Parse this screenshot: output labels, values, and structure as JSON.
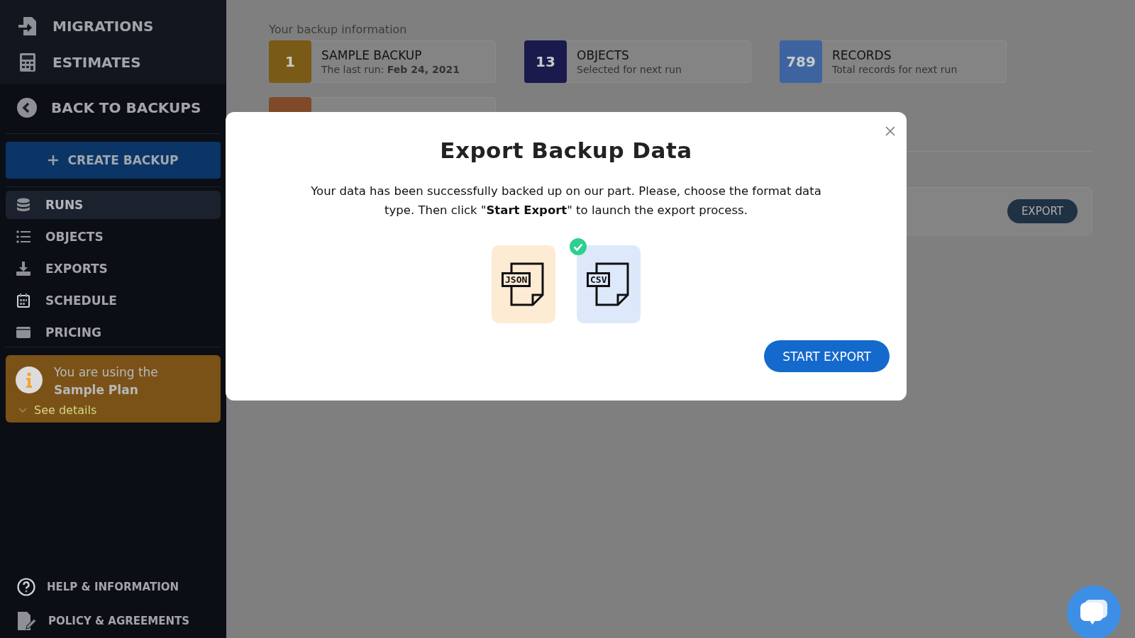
{
  "sidebar": {
    "top_items": [
      {
        "label": "MIGRATIONS"
      },
      {
        "label": "ESTIMATES"
      }
    ],
    "back_link": "BACK TO BACKUPS",
    "create_button": "CREATE BACKUP",
    "items": [
      {
        "label": "RUNS",
        "selected": true
      },
      {
        "label": "OBJECTS",
        "selected": false
      },
      {
        "label": "EXPORTS",
        "selected": false
      },
      {
        "label": "SCHEDULE",
        "selected": false
      },
      {
        "label": "PRICING",
        "selected": false
      }
    ],
    "plan_notice": {
      "text": "You are using the **Sample Plan**",
      "link": "See details"
    },
    "bottom_items": [
      {
        "label": "HELP & INFORMATION"
      },
      {
        "label": "POLICY & AGREEMENTS"
      }
    ]
  },
  "backup_info": {
    "heading": "Your backup information",
    "cards": [
      {
        "badge": "1",
        "title": "SAMPLE BACKUP",
        "subtitle": "The last run: **Feb 24, 2021**",
        "color": "#7a5a17"
      },
      {
        "badge": "13",
        "title": "OBJECTS",
        "subtitle": "Selected for next run",
        "color": "#1b1a4d"
      },
      {
        "badge": "789",
        "title": "RECORDS",
        "subtitle": "Total records for next run",
        "color": "#3d64a0"
      }
    ]
  },
  "run_row": {
    "export_button": "EXPORT"
  },
  "modal": {
    "title": "Export Backup Data",
    "text": "Your data has been successfully backed up on our part. Please, choose the format data type. Then click \"**Start Export**\" to launch the export process.",
    "formats": [
      {
        "label": "JSON",
        "selected": false,
        "color": "#fdebd3"
      },
      {
        "label": "CSV",
        "selected": true,
        "color": "#dde9fb"
      }
    ],
    "start_button": "START EXPORT"
  }
}
